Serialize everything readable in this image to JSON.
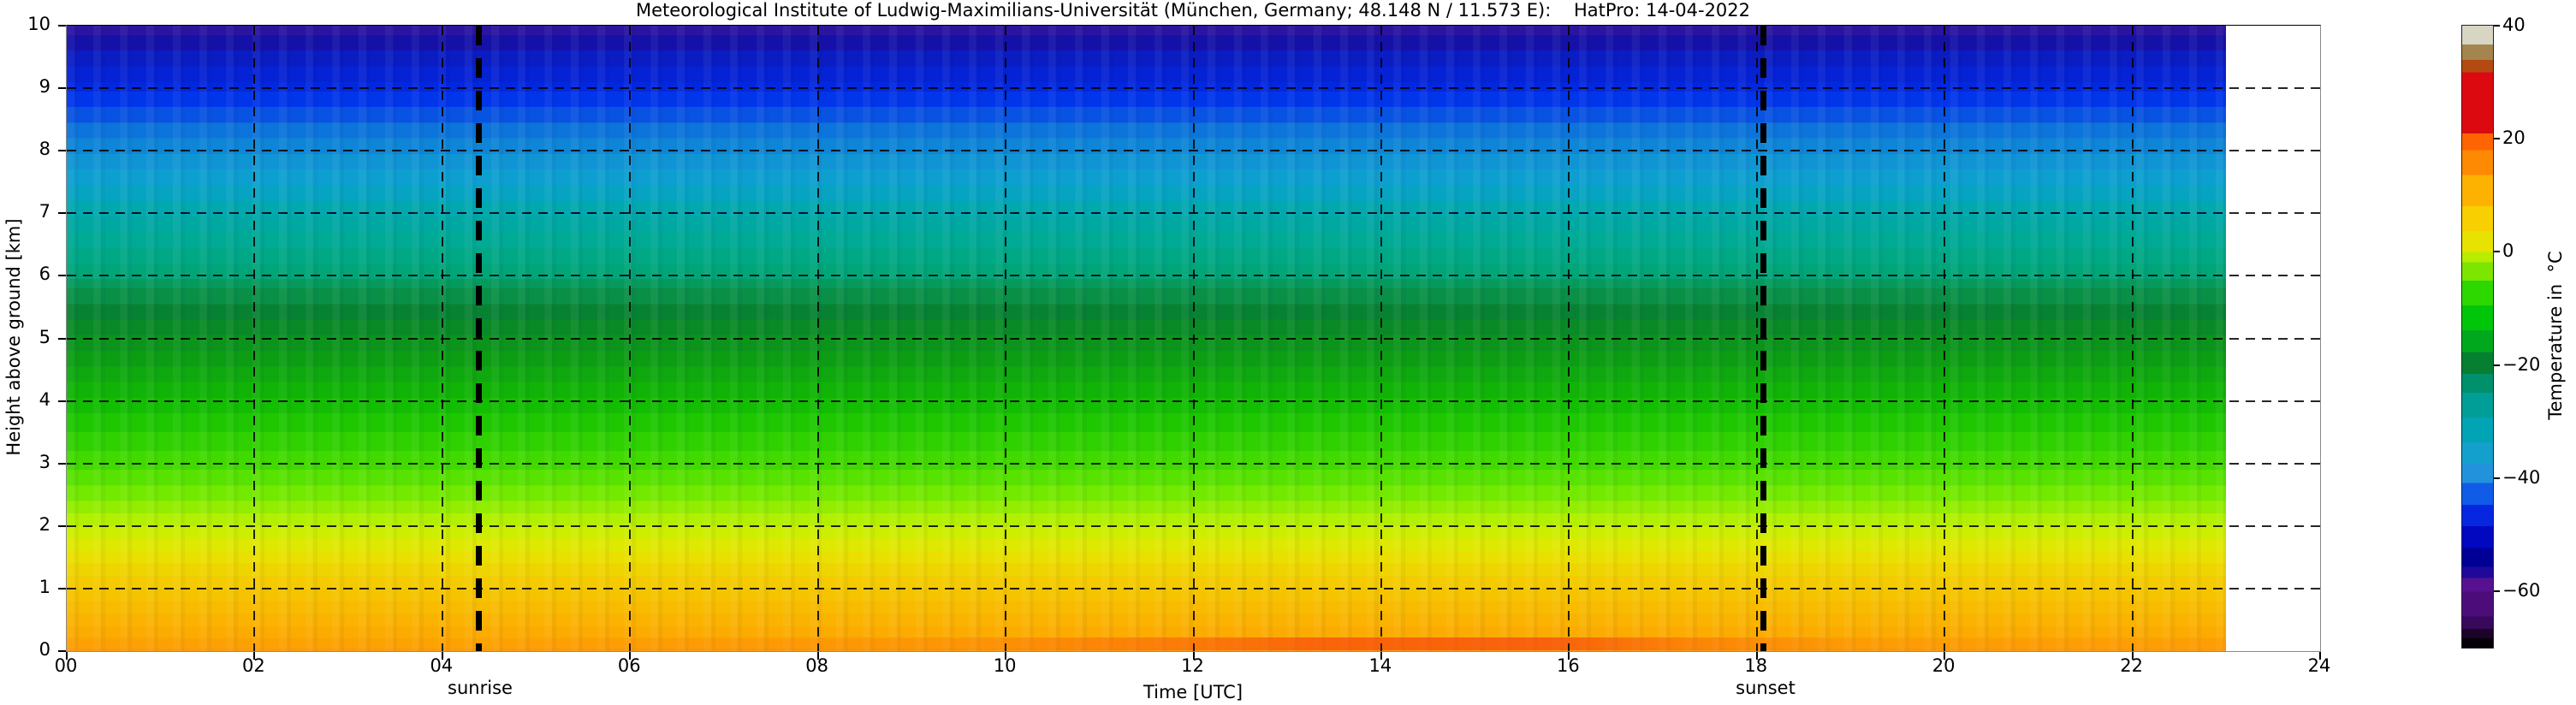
{
  "title": "Meteorological Institute of Ludwig-Maximilians-Universität (München, Germany; 48.148 N / 11.573 E):    HatPro: 14-04-2022",
  "x_axis": {
    "label": "Time [UTC]",
    "ticks": [
      "00",
      "02",
      "04",
      "06",
      "08",
      "10",
      "12",
      "14",
      "16",
      "18",
      "20",
      "22",
      "24"
    ]
  },
  "y_axis": {
    "label": "Height above ground [km]",
    "ticks": [
      "10",
      "9",
      "8",
      "7",
      "6",
      "5",
      "4",
      "3",
      "2",
      "1",
      "0"
    ]
  },
  "annotations": {
    "sunrise": "sunrise",
    "sunset": "sunset"
  },
  "colorbar": {
    "label": "Temperature in  °C",
    "ticks": [
      "40",
      "20",
      "0",
      "−20",
      "−40",
      "−60"
    ]
  },
  "chart_data": {
    "type": "heatmap",
    "title": "Meteorological Institute of Ludwig-Maximilians-Universität (München, Germany; 48.148 N / 11.573 E):    HatPro: 14-04-2022",
    "xlabel": "Time [UTC]",
    "ylabel": "Height above ground [km]",
    "value_label": "Temperature in °C",
    "x_range_hours_utc": [
      0,
      24
    ],
    "x_tick_step_hours": 2,
    "x_data_end_hour": 23,
    "y_range_km": [
      0,
      10
    ],
    "y_tick_step_km": 1,
    "colorbar_tick_values_c": [
      40,
      20,
      0,
      -20,
      -40,
      -60
    ],
    "colorbar_range_c": [
      40,
      -70
    ],
    "sunrise_line_hour_utc": 4.4,
    "sunset_line_hour_utc": 18.1,
    "gridlines": "black dashed every 2 h (vertical) and every 1 km (horizontal)",
    "stratification_note": "Temperature field is nearly horizontally uniform all day; it decreases monotonically with height. Data gap (white) from 23:00 to 24:00 UTC.",
    "surface_diurnal_note": "Lowest ~150 m warm from ~12 °C overnight to ~18–20 °C between about 12:00 and 17:00 UTC (orange-red fringe at the bottom).",
    "temperature_profile_estimate": [
      {
        "height_km": 0.0,
        "temp_c": 14
      },
      {
        "height_km": 0.5,
        "temp_c": 12
      },
      {
        "height_km": 1.0,
        "temp_c": 9
      },
      {
        "height_km": 1.5,
        "temp_c": 6
      },
      {
        "height_km": 2.0,
        "temp_c": 3
      },
      {
        "height_km": 2.5,
        "temp_c": 0
      },
      {
        "height_km": 3.0,
        "temp_c": -3
      },
      {
        "height_km": 3.5,
        "temp_c": -6
      },
      {
        "height_km": 4.0,
        "temp_c": -10
      },
      {
        "height_km": 4.5,
        "temp_c": -13
      },
      {
        "height_km": 5.0,
        "temp_c": -16
      },
      {
        "height_km": 5.5,
        "temp_c": -20
      },
      {
        "height_km": 6.0,
        "temp_c": -23
      },
      {
        "height_km": 6.5,
        "temp_c": -26
      },
      {
        "height_km": 7.0,
        "temp_c": -30
      },
      {
        "height_km": 7.5,
        "temp_c": -33
      },
      {
        "height_km": 8.0,
        "temp_c": -37
      },
      {
        "height_km": 8.5,
        "temp_c": -43
      },
      {
        "height_km": 9.0,
        "temp_c": -50
      },
      {
        "height_km": 9.5,
        "temp_c": -54
      },
      {
        "height_km": 10.0,
        "temp_c": -57
      }
    ],
    "colormap_stops": [
      [
        "40",
        "#d6d6c2"
      ],
      [
        "38",
        "#a5854f"
      ],
      [
        "36",
        "#b34a12"
      ],
      [
        "30",
        "#dc0a10"
      ],
      [
        "21",
        "#dc0a10"
      ],
      [
        "19",
        "#fe6502"
      ],
      [
        "14",
        "#fdb202"
      ],
      [
        "5",
        "#e8e200"
      ],
      [
        "0",
        "#b8ec00"
      ],
      [
        "-5",
        "#2cd800"
      ],
      [
        "-10",
        "#00c60a"
      ],
      [
        "-15",
        "#00a81e"
      ],
      [
        "-20",
        "#068030"
      ],
      [
        "-25",
        "#00906c"
      ],
      [
        "-30",
        "#009e96"
      ],
      [
        "-35",
        "#14a0cc"
      ],
      [
        "-40",
        "#2292dc"
      ],
      [
        "-45",
        "#105ce8"
      ],
      [
        "-50",
        "#0108c0"
      ],
      [
        "-55",
        "#000096"
      ],
      [
        "-58",
        "#20089a"
      ],
      [
        "-62",
        "#571190"
      ],
      [
        "-66",
        "#38085c"
      ],
      [
        "-70",
        "#050008"
      ]
    ]
  }
}
